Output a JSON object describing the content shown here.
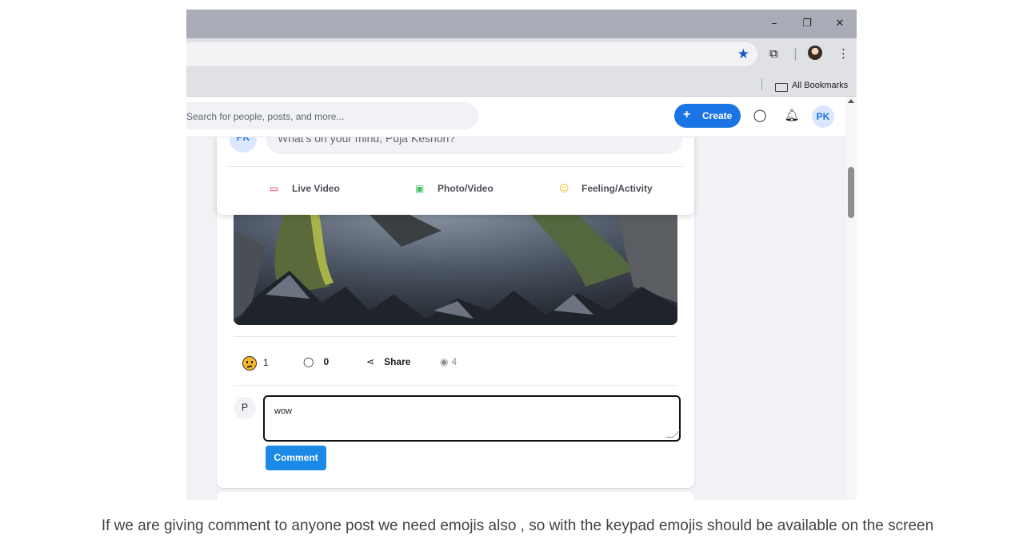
{
  "window": {
    "minimize": "–",
    "restore": "❐",
    "close": "✕"
  },
  "toolbar": {
    "extensions_icon": "puzzle-icon",
    "menu_icon": "kebab-icon"
  },
  "bookmarks": {
    "label": "All Bookmarks"
  },
  "app_header": {
    "search_placeholder": "Search for people, posts, and more...",
    "create_label": "Create",
    "avatar_initials": "PK"
  },
  "composer": {
    "avatar_initials": "PK",
    "placeholder": "What's on your mind, Puja Keshori?",
    "actions": [
      {
        "label": "Live Video",
        "icon": "video-camera-icon",
        "color": "#e41e3f"
      },
      {
        "label": "Photo/Video",
        "icon": "image-icon",
        "color": "#45bd62"
      },
      {
        "label": "Feeling/Activity",
        "icon": "smiley-icon",
        "color": "#f7b928"
      }
    ]
  },
  "post": {
    "reaction_count": "1",
    "comment_count": "0",
    "share_label": "Share",
    "view_count": "4",
    "comment_avatar": "P",
    "comment_text": "wow",
    "comment_button": "Comment"
  },
  "caption": "If we are giving comment to anyone post we need emojis also , so with the keypad emojis should be available on the screen"
}
